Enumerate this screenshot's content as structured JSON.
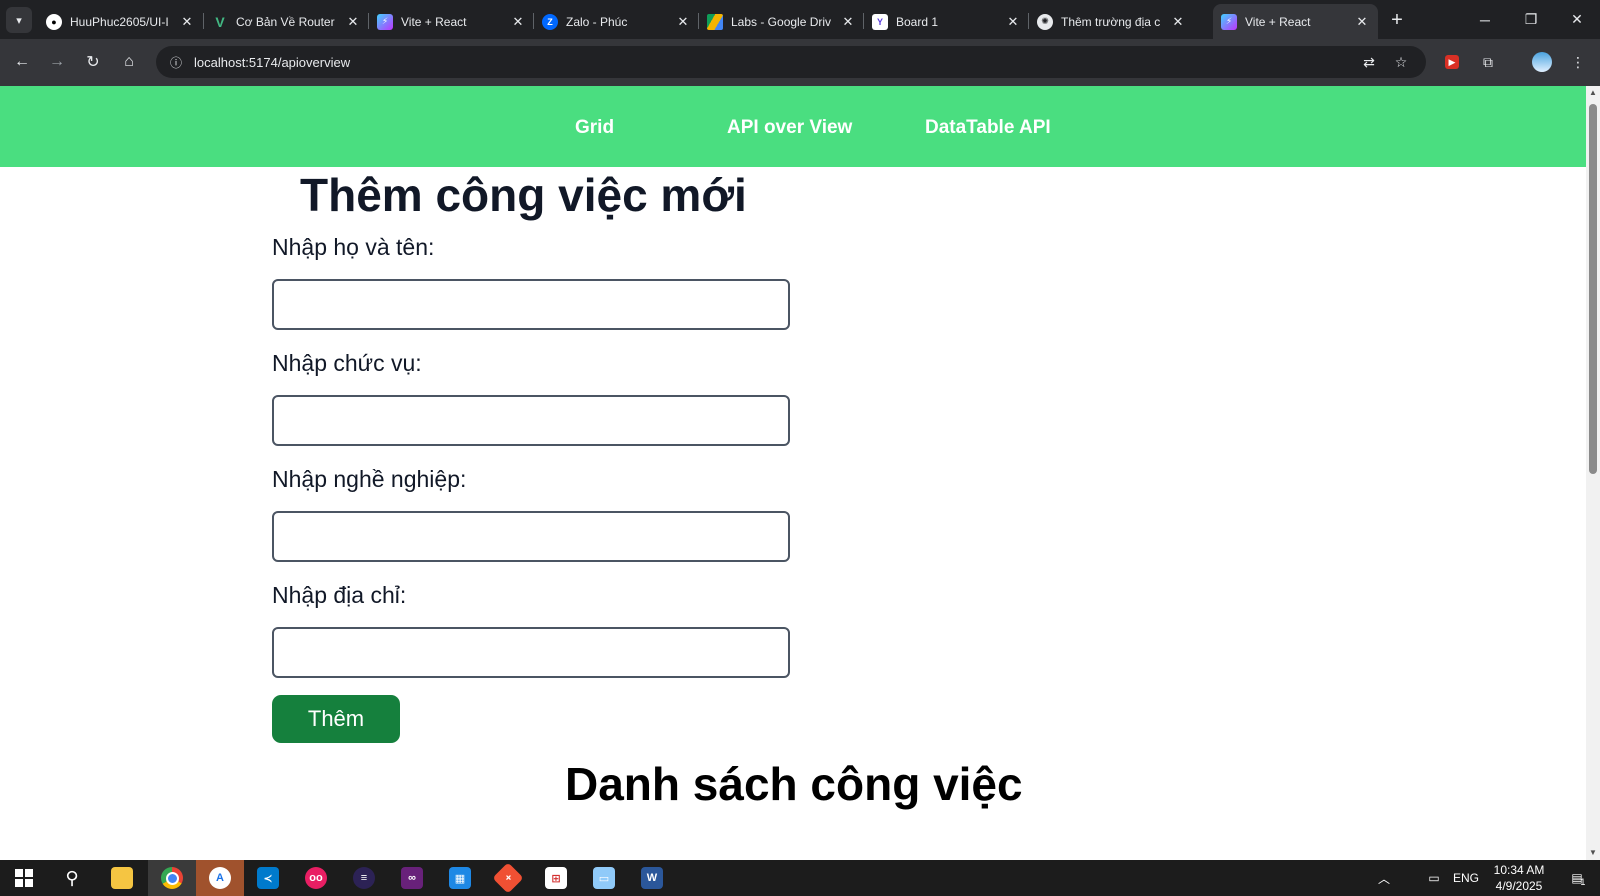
{
  "browser": {
    "tabs": [
      {
        "title": "HuuPhuc2605/UI-I",
        "icon": "github-icon",
        "active": false
      },
      {
        "title": "Cơ Bản Về Router",
        "icon": "vuejs-icon",
        "active": false
      },
      {
        "title": "Vite + React",
        "icon": "vite-icon",
        "active": false
      },
      {
        "title": "Zalo - Phúc",
        "icon": "zalo-icon",
        "active": false
      },
      {
        "title": "Labs - Google Driv",
        "icon": "google-drive-icon",
        "active": false
      },
      {
        "title": "Board 1",
        "icon": "board-icon",
        "active": false
      },
      {
        "title": "Thêm trường địa c",
        "icon": "openai-icon",
        "active": false
      },
      {
        "title": "Vite + React",
        "icon": "vite-icon",
        "active": true
      }
    ],
    "url": "localhost:5174/apioverview"
  },
  "nav": {
    "links": [
      "Grid",
      "API over View",
      "DataTable API"
    ]
  },
  "form": {
    "title": "Thêm công việc mới",
    "fields": [
      {
        "label": "Nhập họ và tên:",
        "value": ""
      },
      {
        "label": "Nhập chức vụ:",
        "value": ""
      },
      {
        "label": "Nhập nghề nghiệp:",
        "value": ""
      },
      {
        "label": "Nhập địa chỉ:",
        "value": ""
      }
    ],
    "submit_label": "Thêm"
  },
  "list": {
    "title": "Danh sách công việc"
  },
  "taskbar": {
    "language": "ENG",
    "time": "10:34 AM",
    "date": "4/9/2025",
    "notification_count": "1"
  },
  "colors": {
    "navbar": "#4ade80",
    "button": "#15803d",
    "title_text": "#111827"
  }
}
